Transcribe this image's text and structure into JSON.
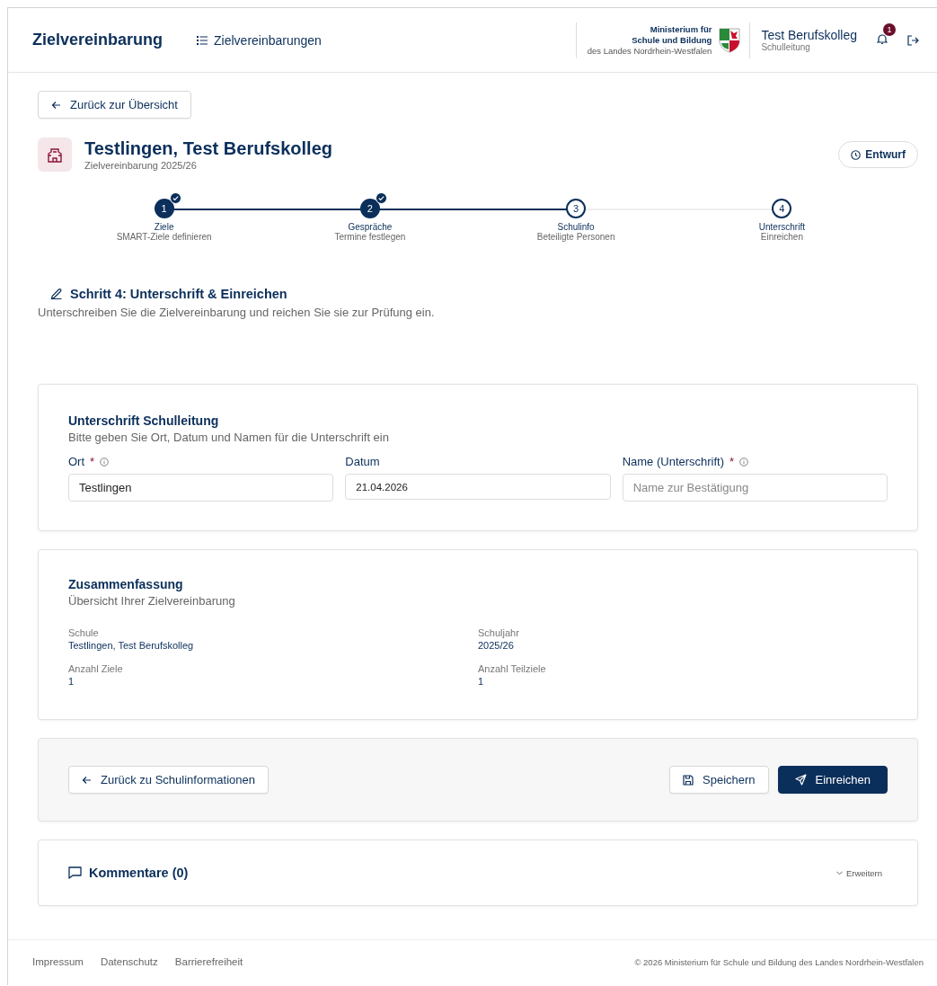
{
  "header": {
    "brand": "Zielvereinbarung",
    "nav_link": "Zielvereinbarungen",
    "ministry": [
      "Ministerium für",
      "Schule und Bildung",
      "des Landes Nordrhein-Westfalen"
    ],
    "school": "Test Berufskolleg",
    "role": "Schulleitung",
    "notification_count": "1"
  },
  "back_button": "Zurück zur Übersicht",
  "page_title": "Testlingen, Test Berufskolleg",
  "page_subtitle": "Zielvereinbarung 2025/26",
  "status_badge": "Entwurf",
  "steps": [
    {
      "number": "1",
      "title": "Ziele",
      "subtitle": "SMART-Ziele definieren",
      "completed": true
    },
    {
      "number": "2",
      "title": "Gespräche",
      "subtitle": "Termine festlegen",
      "completed": true
    },
    {
      "number": "3",
      "title": "Schulinfo",
      "subtitle": "Beteiligte Personen",
      "completed": false
    },
    {
      "number": "4",
      "title": "Unterschrift",
      "subtitle": "Einreichen",
      "completed": false
    }
  ],
  "section": {
    "title": "Schritt 4: Unterschrift & Einreichen",
    "description": "Unterschreiben Sie die Zielvereinbarung und reichen Sie sie zur Prüfung ein."
  },
  "signature_card": {
    "title": "Unterschrift Schulleitung",
    "description": "Bitte geben Sie Ort, Datum und Namen für die Unterschrift ein",
    "fields": [
      {
        "label": "Ort",
        "required_mark": "*",
        "info": true,
        "value": "Testlingen"
      },
      {
        "label": "Datum",
        "info": false,
        "value": "21.04.2026"
      },
      {
        "label": "Name (Unterschrift)",
        "required_mark": "*",
        "info": true,
        "placeholder": "Name zur Bestätigung"
      }
    ]
  },
  "summary_card": {
    "title": "Zusammenfassung",
    "description": "Übersicht Ihrer Zielvereinbarung",
    "items": [
      {
        "label": "Schule",
        "value": "Testlingen, Test Berufskolleg"
      },
      {
        "label": "Schuljahr",
        "value": "2025/26"
      },
      {
        "label": "Anzahl Ziele",
        "value": "1"
      },
      {
        "label": "Anzahl Teilziele",
        "value": "1"
      }
    ]
  },
  "actions": {
    "back": "Zurück zu Schulinformationen",
    "save": "Speichern",
    "submit": "Einreichen"
  },
  "comments": {
    "title": "Kommentare (0)",
    "expand": "Erweitern"
  },
  "footer": {
    "links": [
      "Impressum",
      "Datenschutz",
      "Barrierefreiheit"
    ],
    "copyright": "© 2026 Ministerium für Schule und Bildung des Landes Nordrhein-Westfalen"
  }
}
